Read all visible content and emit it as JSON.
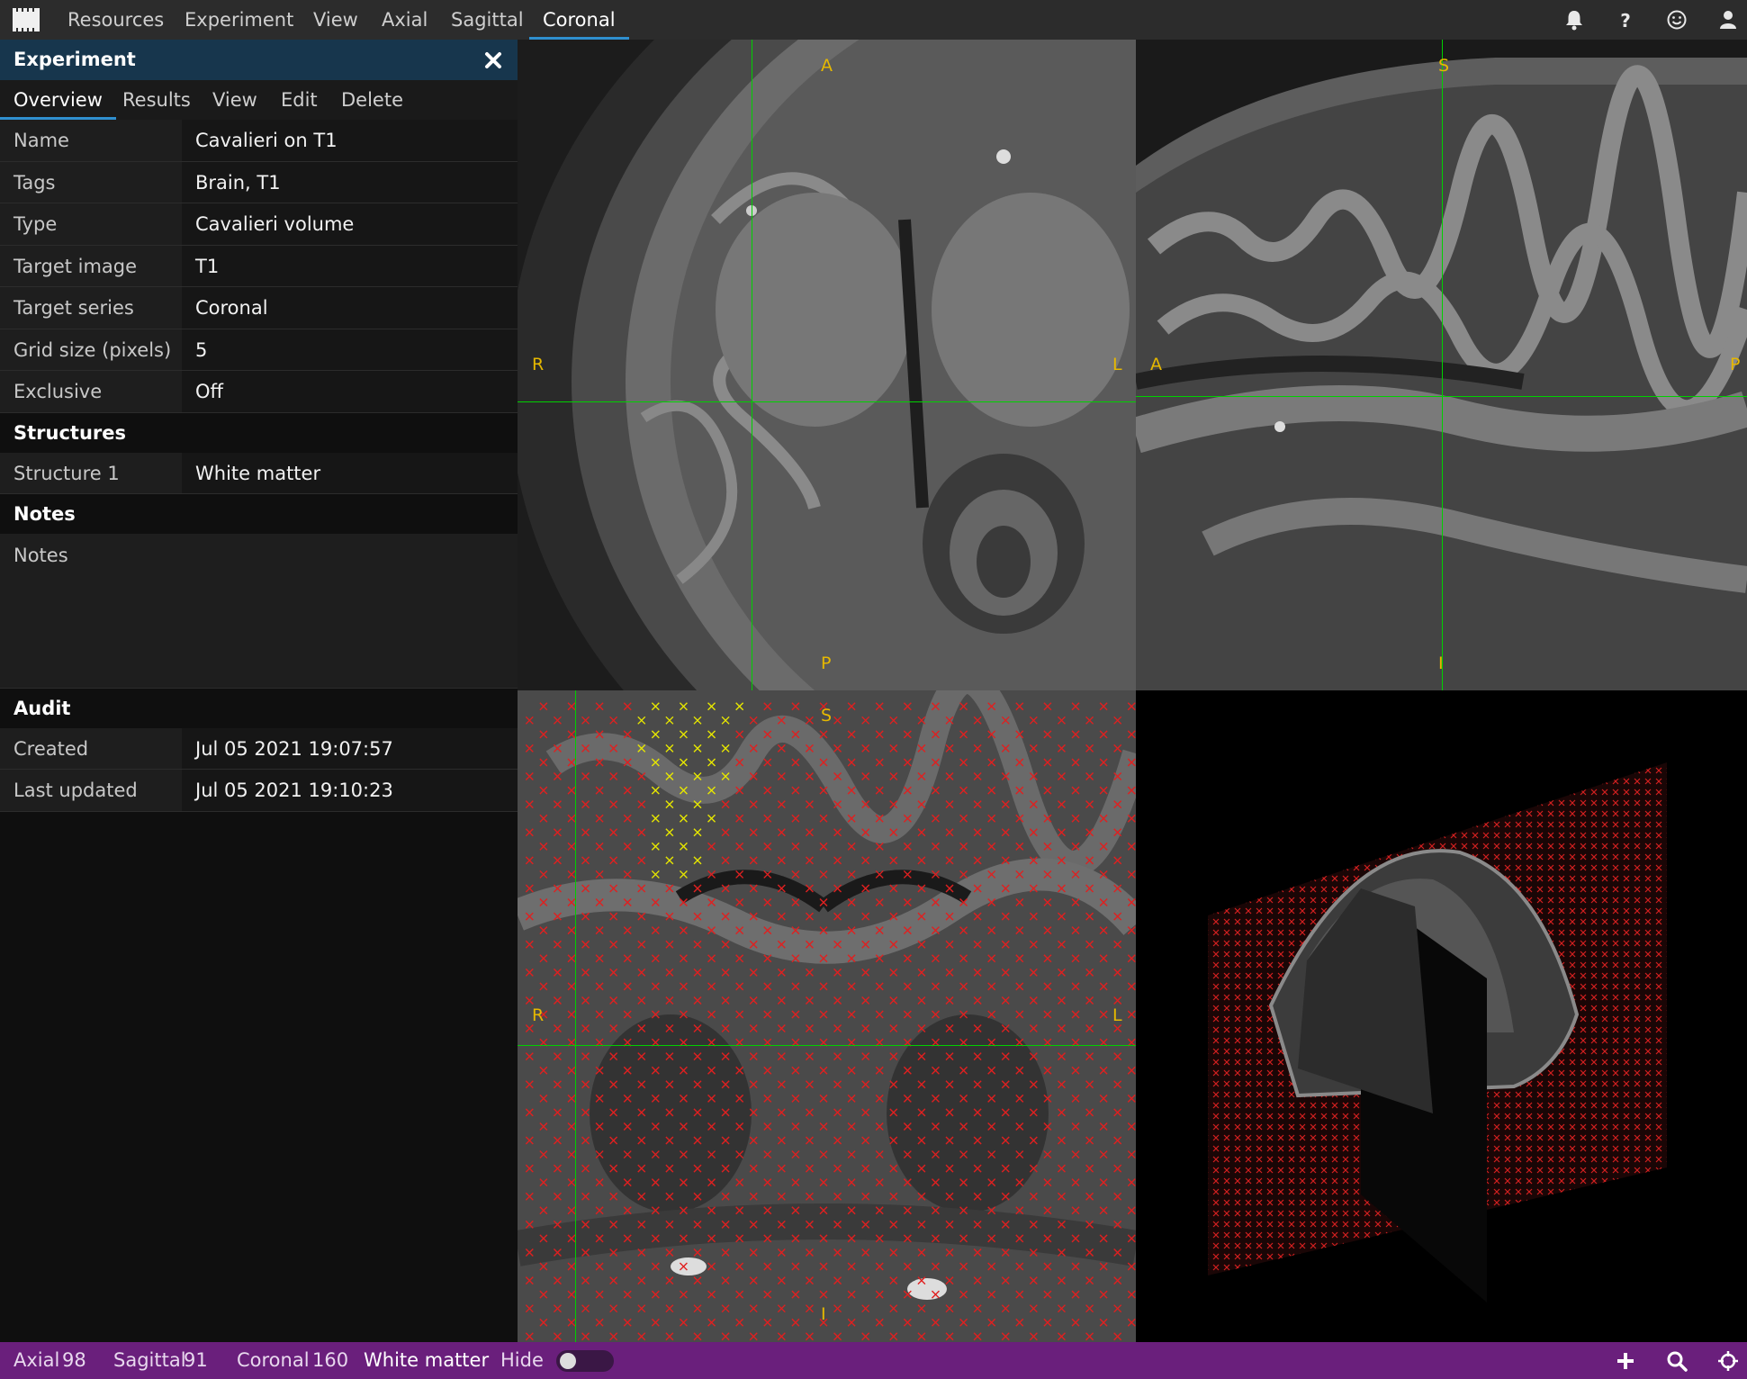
{
  "topbar": {
    "menus": [
      "Resources",
      "Experiment",
      "View",
      "Axial",
      "Sagittal",
      "Coronal"
    ],
    "active_menu": "Coronal",
    "icons": [
      "bell-icon",
      "help-icon",
      "smiley-icon",
      "user-icon"
    ]
  },
  "panel": {
    "title": "Experiment",
    "tabs": [
      "Overview",
      "Results",
      "View",
      "Edit",
      "Delete"
    ],
    "active_tab": "Overview",
    "properties": [
      {
        "label": "Name",
        "value": "Cavalieri on T1"
      },
      {
        "label": "Tags",
        "value": "Brain, T1"
      },
      {
        "label": "Type",
        "value": "Cavalieri volume"
      },
      {
        "label": "Target image",
        "value": "T1"
      },
      {
        "label": "Target series",
        "value": "Coronal"
      },
      {
        "label": "Grid size (pixels)",
        "value": "5"
      },
      {
        "label": "Exclusive",
        "value": "Off"
      }
    ],
    "structures_heading": "Structures",
    "structures": [
      {
        "label": "Structure 1",
        "value": "White matter"
      }
    ],
    "notes_heading": "Notes",
    "notes": {
      "label": "Notes",
      "value": ""
    },
    "audit_heading": "Audit",
    "audit": [
      {
        "label": "Created",
        "value": "Jul 05 2021 19:07:57"
      },
      {
        "label": "Last updated",
        "value": "Jul 05 2021 19:10:23"
      }
    ]
  },
  "views": {
    "axial": {
      "top": "A",
      "bottom": "P",
      "left": "R",
      "right": "L"
    },
    "sagittal": {
      "top": "S",
      "bottom": "I",
      "left": "A",
      "right": "P"
    },
    "coronal": {
      "top": "S",
      "bottom": "I",
      "left": "R",
      "right": "L"
    }
  },
  "colors": {
    "crosshair": "#00d000",
    "grid_marker": "#e02020",
    "selected_marker": "#e6e600",
    "orientation_label": "#e6b800",
    "statusbar": "#6a1f7c",
    "panel_header": "#17364d",
    "accent": "#2f8fcf"
  },
  "statusbar": {
    "axial_label": "Axial",
    "axial_value": "98",
    "sagittal_label": "Sagittal",
    "sagittal_value": "91",
    "coronal_label": "Coronal",
    "coronal_value": "160",
    "structure": "White matter",
    "hide_label": "Hide",
    "hide_toggle": false,
    "icons": [
      "plus-icon",
      "search-icon",
      "crosshair-icon"
    ]
  }
}
